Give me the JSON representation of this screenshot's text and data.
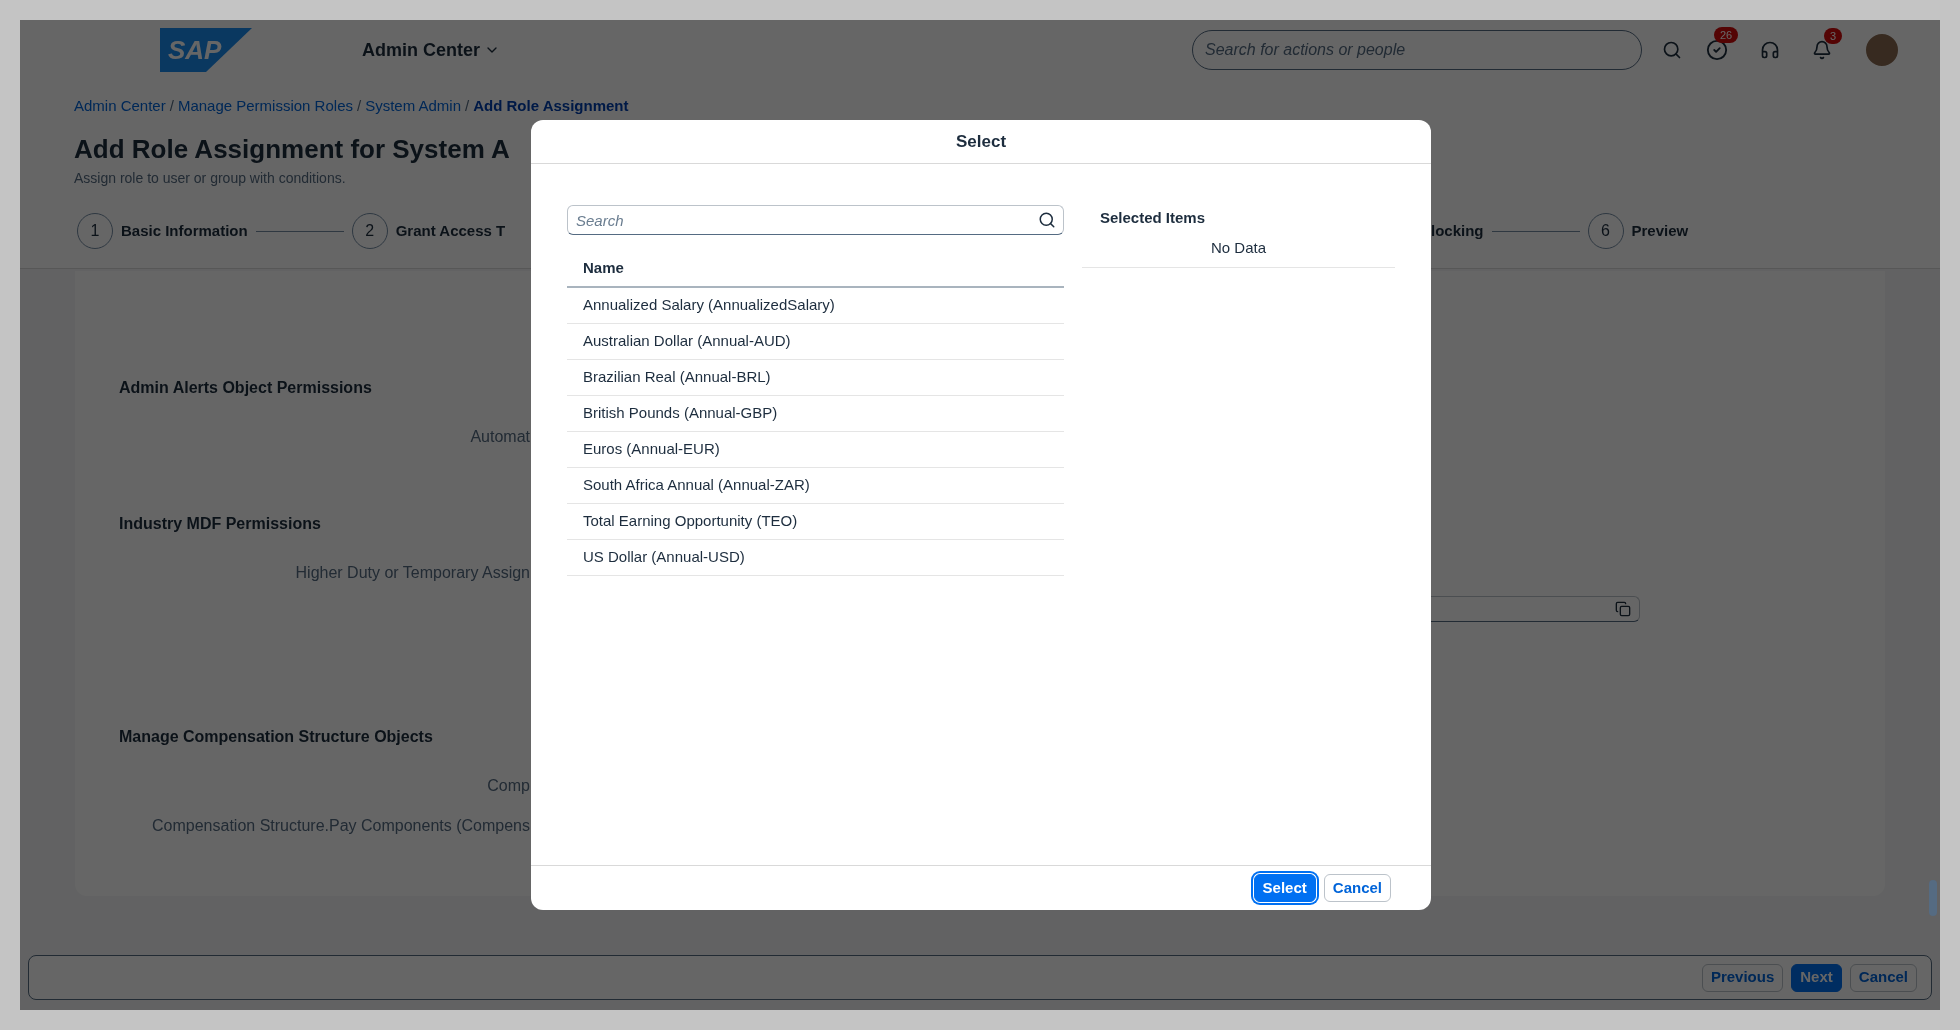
{
  "header": {
    "logo": "SAP",
    "app_menu": "Admin Center",
    "search": {
      "placeholder": "Search for actions or people"
    },
    "todo_badge": "26",
    "notification_badge": "3"
  },
  "breadcrumb": [
    {
      "label": "Admin Center",
      "current": false
    },
    {
      "label": "Manage Permission Roles",
      "current": false
    },
    {
      "label": "System Admin",
      "current": false
    },
    {
      "label": "Add Role Assignment",
      "current": true
    }
  ],
  "breadcrumb_separator": "/",
  "page": {
    "title": "Add Role Assignment for System A",
    "subtitle": "Assign role to user or group with conditions."
  },
  "steps_left": [
    {
      "number": "1",
      "label": "Basic Information"
    },
    {
      "number": "2",
      "label": "Grant Access T"
    }
  ],
  "steps_right": [
    {
      "label": "locking"
    },
    {
      "number": "6",
      "label": "Preview"
    }
  ],
  "sections": [
    {
      "title": "Admin Alerts Object Permissions",
      "fields": [
        "Automat"
      ],
      "value_field": false
    },
    {
      "title": "Industry MDF Permissions",
      "fields": [
        "Higher Duty or Temporary Assign"
      ],
      "value_field": true
    },
    {
      "title": "Manage Compensation Structure Objects",
      "fields": [
        "Comp",
        "Compensation Structure.Pay Components (Compens"
      ],
      "value_field": false
    }
  ],
  "footer_buttons": [
    {
      "label": "Previous",
      "kind": "secondary"
    },
    {
      "label": "Next",
      "kind": "primary"
    },
    {
      "label": "Cancel",
      "kind": "secondary"
    }
  ],
  "dialog": {
    "title": "Select",
    "search": {
      "placeholder": "Search"
    },
    "column": "Name",
    "items": [
      "Annualized Salary (AnnualizedSalary)",
      "Australian Dollar (Annual-AUD)",
      "Brazilian Real (Annual-BRL)",
      "British Pounds (Annual-GBP)",
      "Euros (Annual-EUR)",
      "South Africa Annual (Annual-ZAR)",
      "Total Earning Opportunity (TEO)",
      "US Dollar (Annual-USD)"
    ],
    "selected_title": "Selected Items",
    "selected_empty": "No Data",
    "buttons": [
      {
        "label": "Select",
        "kind": "primary"
      },
      {
        "label": "Cancel",
        "kind": "secondary"
      }
    ]
  }
}
